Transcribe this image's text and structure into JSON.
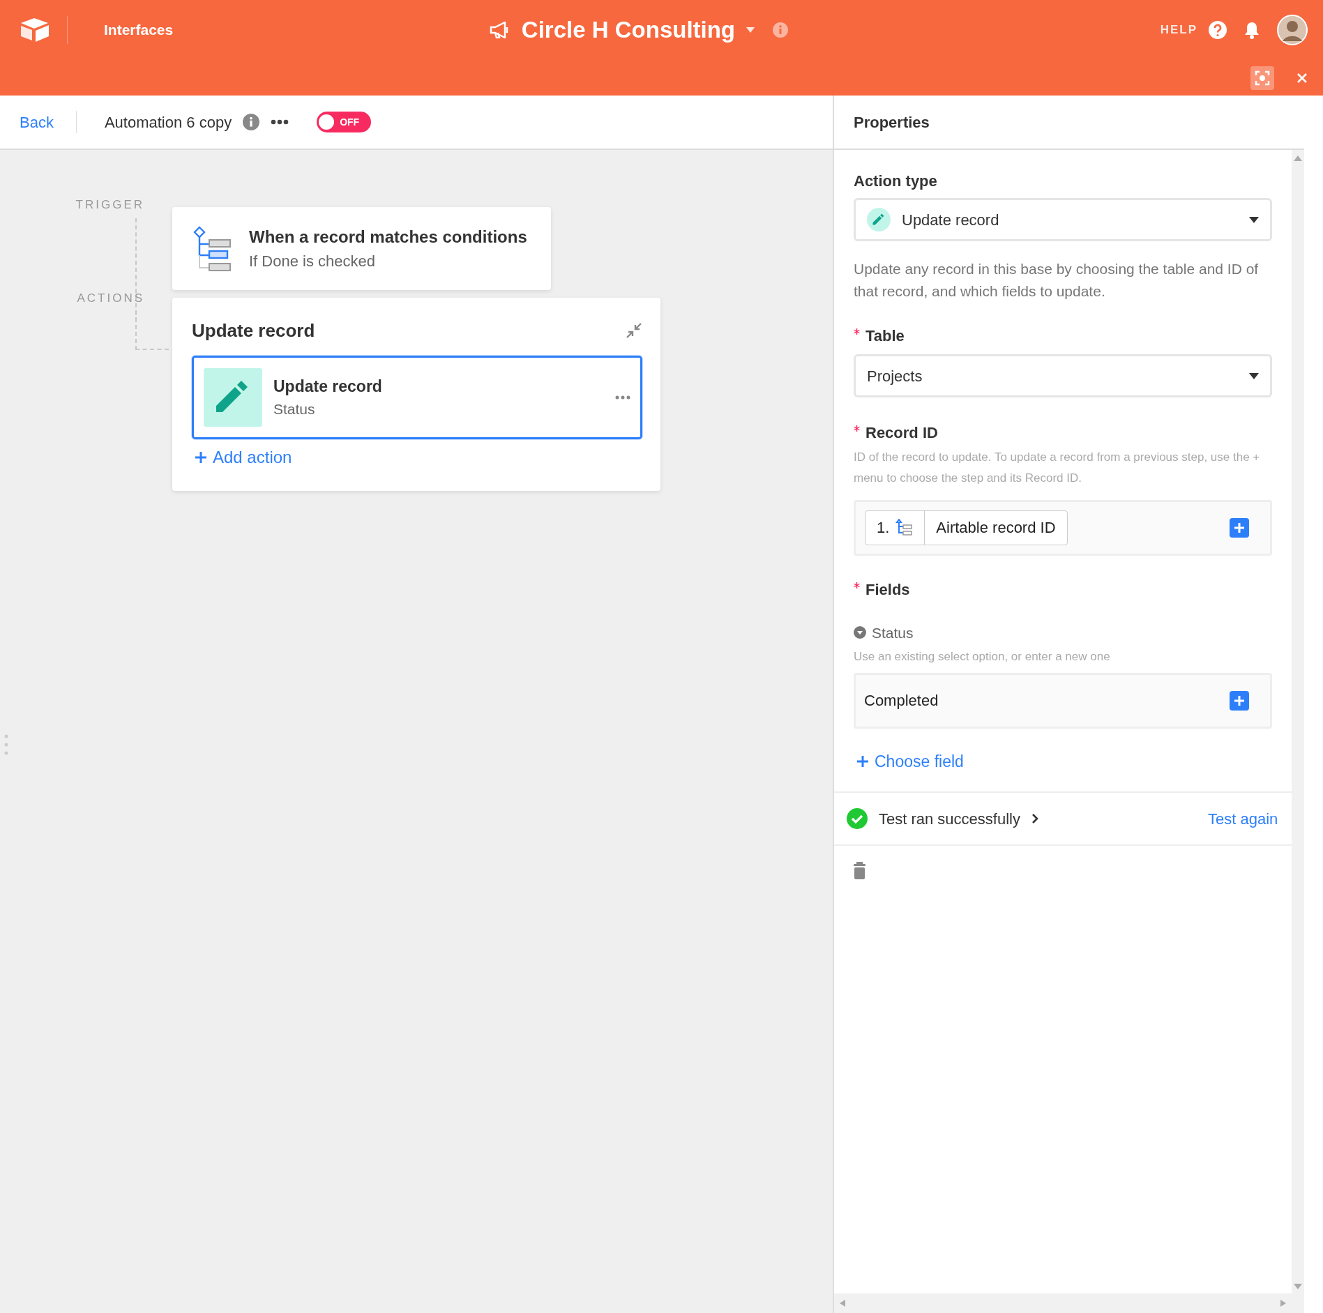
{
  "header": {
    "app_label": "Interfaces",
    "base_name": "Circle H Consulting",
    "help": "HELP"
  },
  "toolbar": {
    "back": "Back",
    "automation_name": "Automation 6 copy",
    "toggle": {
      "label": "OFF",
      "on": false
    }
  },
  "canvas": {
    "trigger_heading": "TRIGGER",
    "trigger": {
      "title": "When a record matches conditions",
      "subtitle": "If Done is checked"
    },
    "actions_heading": "ACTIONS",
    "action_group": {
      "title": "Update record",
      "actions": [
        {
          "title": "Update record",
          "subtitle": "Status",
          "selected": true
        }
      ],
      "add_action": "Add action"
    }
  },
  "properties": {
    "title": "Properties",
    "action_type": {
      "label": "Action type",
      "value": "Update record"
    },
    "description": "Update any record in this base by choosing the table and ID of that record, and which fields to update.",
    "table": {
      "label": "Table",
      "required": true,
      "value": "Projects"
    },
    "record_id": {
      "label": "Record ID",
      "required": true,
      "help": "ID of the record to update. To update a record from a previous step, use the + menu to choose the step and its Record ID.",
      "token": {
        "step": "1.",
        "value": "Airtable record ID"
      }
    },
    "fields": {
      "label": "Fields",
      "required": true,
      "items": [
        {
          "name": "Status",
          "help": "Use an existing select option, or enter a new one",
          "value": "Completed"
        }
      ],
      "choose_field": "Choose field"
    },
    "test": {
      "status": "Test ran successfully",
      "action": "Test again"
    }
  }
}
